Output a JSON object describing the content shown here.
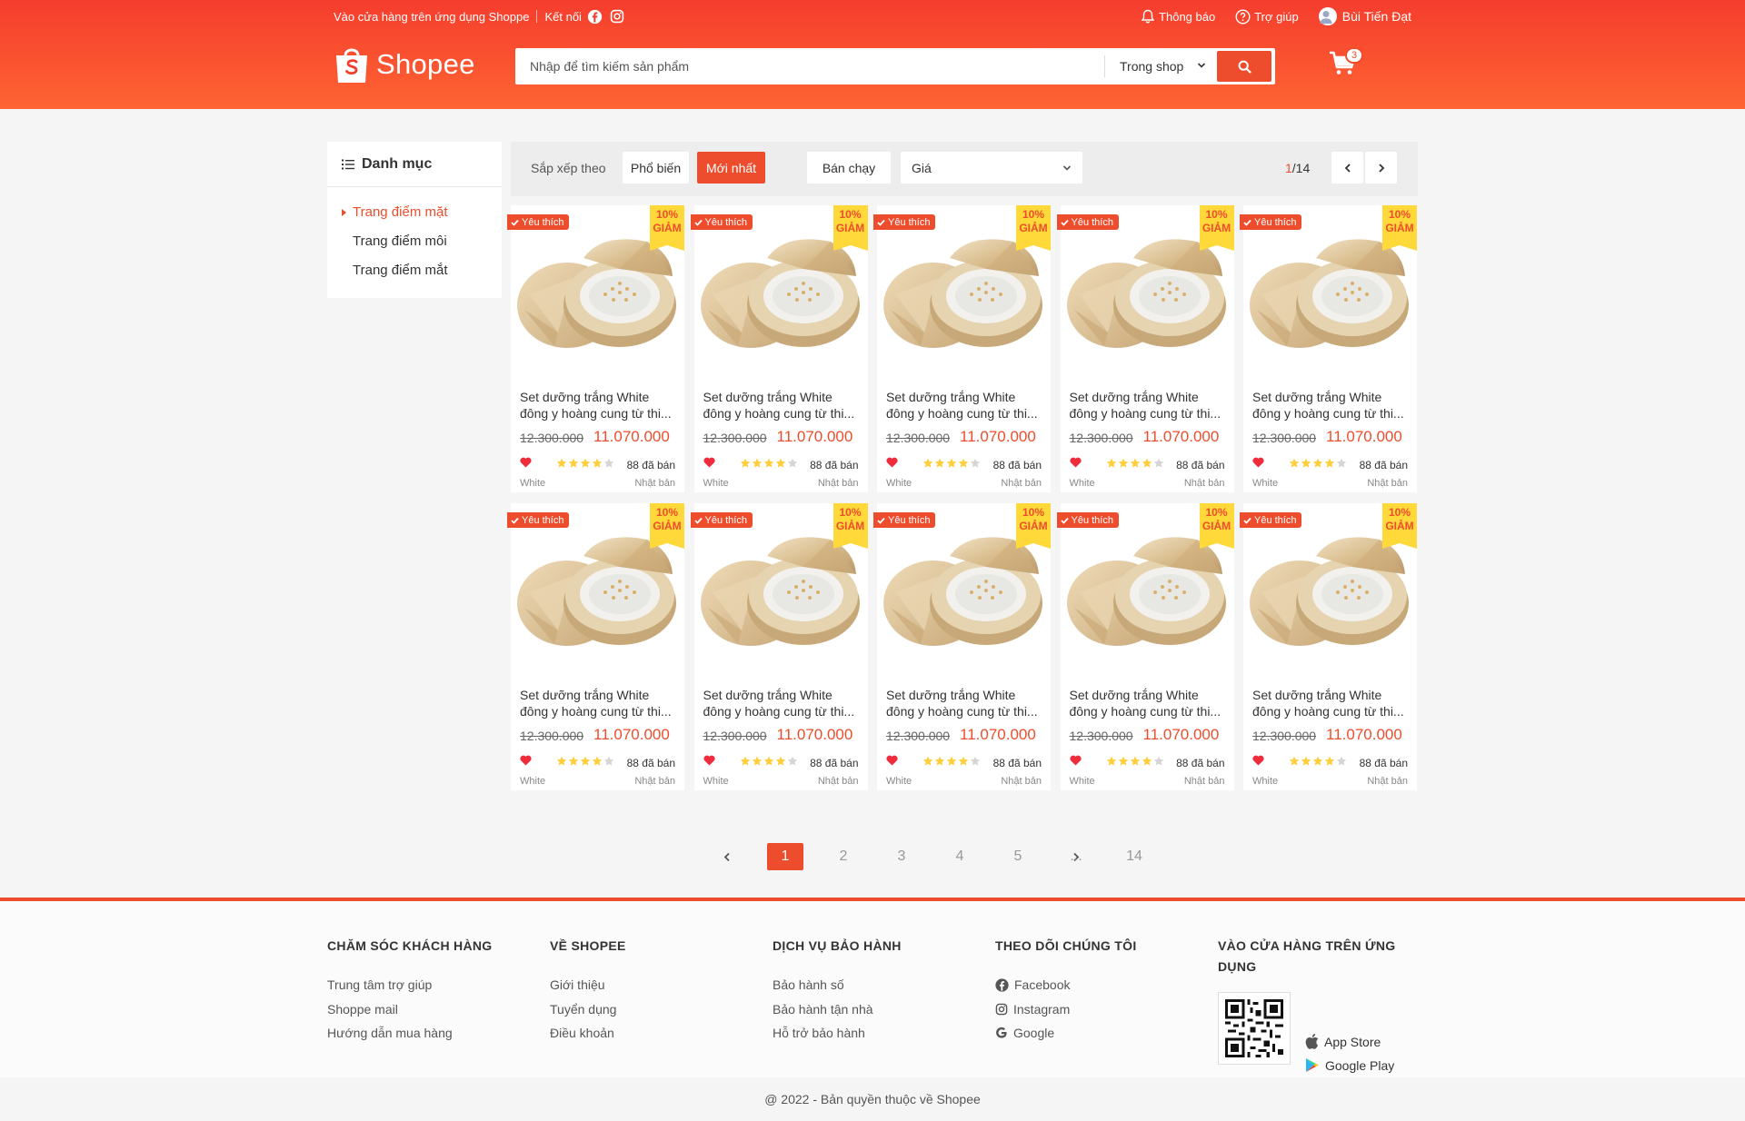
{
  "topbar": {
    "app_link": "Vào cửa hàng trên ứng dụng Shoppe",
    "connect": "Kết nối",
    "notifications": "Thông báo",
    "help": "Trợ giúp",
    "user_name": "Bùi Tiến Đạt"
  },
  "header": {
    "logo_text": "Shopee",
    "search_placeholder": "Nhập để tìm kiếm sản phẩm",
    "search_scope": "Trong shop",
    "cart_count": "3"
  },
  "sidebar": {
    "title": "Danh mục",
    "items": [
      {
        "label": "Trang điểm mặt",
        "active": true
      },
      {
        "label": "Trang điểm môi",
        "active": false
      },
      {
        "label": "Trang điểm mắt",
        "active": false
      }
    ]
  },
  "filter": {
    "sort_label": "Sắp xếp theo",
    "popular": "Phổ biến",
    "newest": "Mới nhất",
    "best_selling": "Bán chạy",
    "price": "Giá",
    "page_current": "1",
    "page_total": "/14"
  },
  "product": {
    "favorite_label": "Yêu thích",
    "discount_pct": "10%",
    "discount_word": "GIẢM",
    "name": "Set dưỡng trắng White đông y hoàng cung từ thiên nhiên",
    "old_price": "12.300.000",
    "new_price": "11.070.000",
    "rating": 4,
    "sold": "88 đã bán",
    "brand": "White",
    "origin": "Nhật bản"
  },
  "pagination": {
    "pages": [
      "1",
      "2",
      "3",
      "4",
      "5",
      "...",
      "14"
    ],
    "active": "1"
  },
  "footer": {
    "col1": {
      "title": "Chăm sóc khách hàng",
      "links": [
        "Trung tâm trợ giúp",
        "Shoppe mail",
        "Hướng dẫn mua hàng"
      ]
    },
    "col2": {
      "title": "Về Shopee",
      "links": [
        "Giới thiệu",
        "Tuyển dụng",
        "Điều khoản"
      ]
    },
    "col3": {
      "title": "Dịch vụ bảo hành",
      "links": [
        "Bảo hành số",
        "Bảo hành tận nhà",
        "Hỗ trở bảo hành"
      ]
    },
    "col4": {
      "title": "Theo dõi chúng tôi",
      "links": [
        "Facebook",
        "Instagram",
        "Google"
      ]
    },
    "col5": {
      "title": "Vào cửa hàng trên ứng dụng",
      "app_store": "App Store",
      "google_play": "Google Play"
    },
    "copyright": "@ 2022 - Bản quyền thuộc về Shopee"
  },
  "colors": {
    "brand": "#ee4d2d",
    "discount_bg": "#ffd839",
    "star": "#ffce3d"
  }
}
